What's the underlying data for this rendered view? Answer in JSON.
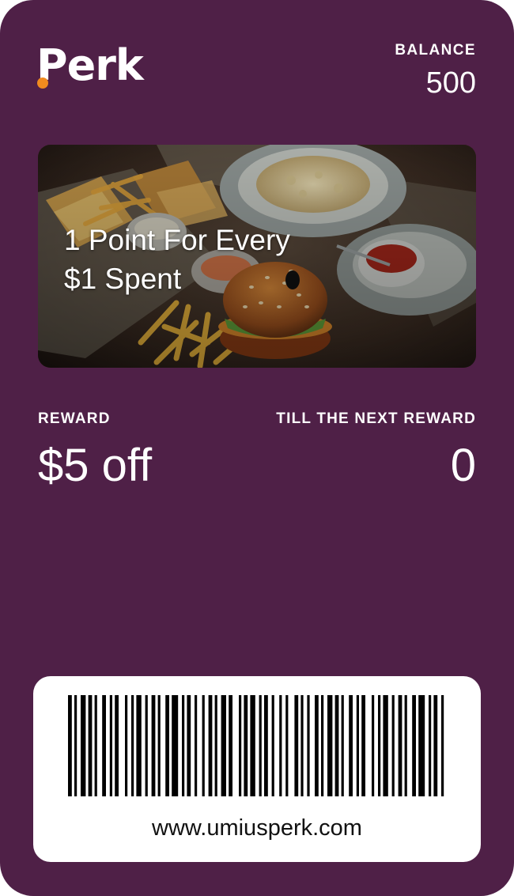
{
  "brand": {
    "name": "Perk",
    "card_color": "#4f2047",
    "accent_color": "#f08a1f"
  },
  "balance": {
    "label": "BALANCE",
    "value": "500"
  },
  "promo": {
    "line1": "1 Point For Every",
    "line2": "$1 Spent",
    "image": "food-photo"
  },
  "reward": {
    "label": "REWARD",
    "value": "$5 off"
  },
  "next_reward": {
    "label": "TILL THE NEXT REWARD",
    "value": "0"
  },
  "barcode": {
    "url": "www.umiusperk.com",
    "icon": "barcode-icon"
  }
}
